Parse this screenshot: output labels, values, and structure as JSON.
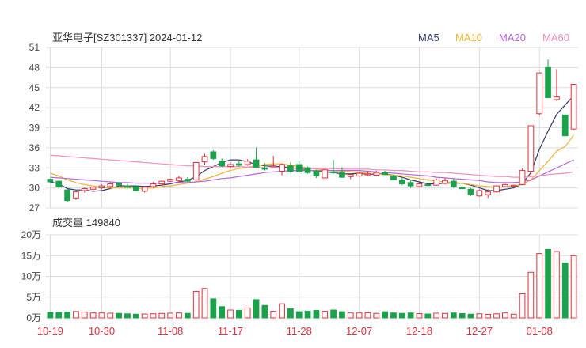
{
  "header": {
    "title": "亚华电子[SZ301337] 2024-01-12"
  },
  "legend": [
    {
      "label": "MA5",
      "color": "#2f3a6b"
    },
    {
      "label": "MA10",
      "color": "#f2b431"
    },
    {
      "label": "MA20",
      "color": "#b36ad8"
    },
    {
      "label": "MA60",
      "color": "#f08fc0"
    }
  ],
  "volume_panel": {
    "label": "成交量 149840"
  },
  "colors": {
    "up": "#e0303a",
    "down": "#1aa34a",
    "grid": "#dcdcdc"
  },
  "chart_data": [
    {
      "type": "candlestick",
      "title": "亚华电子[SZ301337] 2024-01-12",
      "ylim": [
        27,
        51
      ],
      "y_ticks": [
        27,
        30,
        33,
        36,
        39,
        42,
        45,
        48,
        51
      ],
      "x_tick_labels": [
        "10-19",
        "10-30",
        "11-08",
        "11-17",
        "11-28",
        "12-07",
        "12-18",
        "12-27",
        "01-08"
      ],
      "x_tick_indices": [
        0,
        6,
        14,
        21,
        29,
        36,
        43,
        50,
        57
      ],
      "grid": true,
      "legend_position": "top-right",
      "candles": [
        [
          31.3,
          31.4,
          30.7,
          30.9
        ],
        [
          31.0,
          31.1,
          29.9,
          30.2
        ],
        [
          29.7,
          29.8,
          27.9,
          28.1
        ],
        [
          28.5,
          29.6,
          28.2,
          29.4
        ],
        [
          29.6,
          30.1,
          29.3,
          29.9
        ],
        [
          29.8,
          30.3,
          29.5,
          30.1
        ],
        [
          30.0,
          30.5,
          29.8,
          30.3
        ],
        [
          30.2,
          30.8,
          30.0,
          30.6
        ],
        [
          30.7,
          30.9,
          30.2,
          30.4
        ],
        [
          30.3,
          30.6,
          29.9,
          30.1
        ],
        [
          30.2,
          30.4,
          29.5,
          29.6
        ],
        [
          29.5,
          30.2,
          29.3,
          30.1
        ],
        [
          30.2,
          30.9,
          30.0,
          30.6
        ],
        [
          30.6,
          31.2,
          30.5,
          31.0
        ],
        [
          31.0,
          31.4,
          30.9,
          31.3
        ],
        [
          31.1,
          31.8,
          30.9,
          31.5
        ],
        [
          31.3,
          31.6,
          30.9,
          31.0
        ],
        [
          31.2,
          34.0,
          31.0,
          33.8
        ],
        [
          33.9,
          35.1,
          33.5,
          34.7
        ],
        [
          35.4,
          35.6,
          34.2,
          34.4
        ],
        [
          34.0,
          34.4,
          33.1,
          33.3
        ],
        [
          33.2,
          33.8,
          33.0,
          33.5
        ],
        [
          33.6,
          34.0,
          33.2,
          33.4
        ],
        [
          33.5,
          34.3,
          33.3,
          34.0
        ],
        [
          34.2,
          36.0,
          33.0,
          33.1
        ],
        [
          33.0,
          33.7,
          32.6,
          32.8
        ],
        [
          33.2,
          34.8,
          33.1,
          33.3
        ],
        [
          32.5,
          33.7,
          31.9,
          33.5
        ],
        [
          33.3,
          33.8,
          32.3,
          32.5
        ],
        [
          33.5,
          34.0,
          32.3,
          32.5
        ],
        [
          33.0,
          33.2,
          32.1,
          32.3
        ],
        [
          32.5,
          32.7,
          31.5,
          31.8
        ],
        [
          31.5,
          32.9,
          31.3,
          32.7
        ],
        [
          32.4,
          34.2,
          32.1,
          32.3
        ],
        [
          32.3,
          33.1,
          31.5,
          31.6
        ],
        [
          31.7,
          32.1,
          31.3,
          32.0
        ],
        [
          31.8,
          32.4,
          31.7,
          32.2
        ],
        [
          32.0,
          32.5,
          31.8,
          32.1
        ],
        [
          31.9,
          32.6,
          31.8,
          32.3
        ],
        [
          32.3,
          32.6,
          31.9,
          32.0
        ],
        [
          31.8,
          32.0,
          31.1,
          31.2
        ],
        [
          31.2,
          31.6,
          30.4,
          30.6
        ],
        [
          30.8,
          31.2,
          30.0,
          30.3
        ],
        [
          30.2,
          30.9,
          30.1,
          30.6
        ],
        [
          30.5,
          30.8,
          30.2,
          30.4
        ],
        [
          30.4,
          31.4,
          30.3,
          31.2
        ],
        [
          30.7,
          31.5,
          30.5,
          31.1
        ],
        [
          31.0,
          31.4,
          30.0,
          30.2
        ],
        [
          30.1,
          30.3,
          29.7,
          29.9
        ],
        [
          29.8,
          30.0,
          28.8,
          29.0
        ],
        [
          28.8,
          29.8,
          28.7,
          29.6
        ],
        [
          29.0,
          29.8,
          28.5,
          29.4
        ],
        [
          29.4,
          30.4,
          29.3,
          30.3
        ],
        [
          30.2,
          30.6,
          30.1,
          30.5
        ],
        [
          30.3,
          30.5,
          30.1,
          30.4
        ],
        [
          30.5,
          32.9,
          30.4,
          32.6
        ],
        [
          32.5,
          39.3,
          31.0,
          39.3
        ],
        [
          41.1,
          47.2,
          40.9,
          47.2
        ],
        [
          48.0,
          49.2,
          43.4,
          43.5
        ],
        [
          43.2,
          47.8,
          43.0,
          43.6
        ],
        [
          40.9,
          41.0,
          37.7,
          37.8
        ],
        [
          38.8,
          45.5,
          38.7,
          45.5
        ]
      ],
      "ma_series": [
        {
          "name": "MA5",
          "values": [
            30.9,
            30.6,
            29.9,
            29.7,
            29.7,
            29.5,
            29.6,
            29.9,
            30.3,
            30.3,
            30.3,
            30.2,
            30.3,
            30.4,
            30.6,
            30.9,
            31.1,
            31.7,
            32.6,
            33.2,
            33.8,
            34.2,
            34.2,
            33.9,
            33.5,
            33.3,
            33.2,
            33.2,
            33.0,
            32.9,
            32.7,
            32.5,
            32.4,
            32.3,
            32.1,
            32.1,
            32.2,
            32.0,
            32.1,
            32.1,
            31.9,
            31.6,
            31.2,
            30.9,
            30.6,
            30.6,
            30.7,
            30.7,
            30.7,
            30.4,
            30.0,
            29.6,
            29.6,
            29.8,
            30.0,
            30.6,
            32.3,
            35.8,
            38.5,
            41.0,
            42.4,
            43.8
          ]
        },
        {
          "name": "MA10",
          "values": [
            32.2,
            31.8,
            31.2,
            30.8,
            30.5,
            30.3,
            30.1,
            30.0,
            30.0,
            30.0,
            30.0,
            29.9,
            30.0,
            30.2,
            30.3,
            30.5,
            30.7,
            30.9,
            31.3,
            31.7,
            32.2,
            32.6,
            32.9,
            33.1,
            33.3,
            33.5,
            33.6,
            33.6,
            33.4,
            33.2,
            33.0,
            32.8,
            32.7,
            32.6,
            32.5,
            32.4,
            32.3,
            32.2,
            32.1,
            32.0,
            31.9,
            31.8,
            31.6,
            31.4,
            31.2,
            31.0,
            30.9,
            30.8,
            30.7,
            30.5,
            30.3,
            30.2,
            30.1,
            30.2,
            30.3,
            30.5,
            31.2,
            32.6,
            34.0,
            35.5,
            36.2,
            37.9
          ]
        },
        {
          "name": "MA20",
          "values": [
            31.6,
            31.5,
            31.4,
            31.3,
            31.2,
            31.1,
            31.0,
            30.9,
            30.8,
            30.8,
            30.7,
            30.7,
            30.7,
            30.7,
            30.7,
            30.8,
            30.8,
            30.9,
            31.0,
            31.2,
            31.4,
            31.5,
            31.7,
            31.9,
            32.1,
            32.3,
            32.4,
            32.5,
            32.6,
            32.6,
            32.6,
            32.6,
            32.6,
            32.6,
            32.6,
            32.6,
            32.6,
            32.5,
            32.4,
            32.3,
            32.2,
            32.1,
            32.0,
            31.9,
            31.8,
            31.6,
            31.5,
            31.4,
            31.3,
            31.2,
            31.1,
            30.9,
            30.8,
            30.8,
            30.8,
            30.9,
            31.2,
            31.8,
            32.4,
            33.0,
            33.6,
            34.2
          ]
        },
        {
          "name": "MA60",
          "values": [
            34.9,
            34.8,
            34.7,
            34.6,
            34.5,
            34.4,
            34.3,
            34.2,
            34.1,
            34.0,
            33.9,
            33.8,
            33.7,
            33.6,
            33.5,
            33.4,
            33.3,
            33.3,
            33.2,
            33.2,
            33.2,
            33.2,
            33.2,
            33.1,
            33.1,
            33.0,
            33.0,
            33.0,
            33.0,
            32.9,
            32.9,
            32.9,
            32.9,
            32.9,
            32.8,
            32.8,
            32.8,
            32.8,
            32.7,
            32.7,
            32.6,
            32.6,
            32.5,
            32.4,
            32.4,
            32.3,
            32.3,
            32.2,
            32.1,
            32.0,
            31.9,
            31.8,
            31.7,
            31.7,
            31.6,
            31.6,
            31.7,
            31.8,
            32.0,
            32.1,
            32.2,
            32.4
          ]
        }
      ]
    },
    {
      "type": "bar",
      "title": "成交量 149840",
      "ylim": [
        0,
        200000
      ],
      "y_tick_labels": [
        "0万",
        "5万",
        "10万",
        "15万",
        "20万"
      ],
      "grid": true,
      "volumes": [
        13500,
        13000,
        14000,
        15500,
        14000,
        12000,
        12000,
        11500,
        11000,
        10000,
        9000,
        9500,
        10000,
        11000,
        11500,
        12000,
        11000,
        64000,
        71000,
        46000,
        27000,
        19000,
        18000,
        24000,
        44000,
        30000,
        16000,
        34000,
        22000,
        15000,
        16000,
        18000,
        16000,
        19000,
        15000,
        12000,
        12000,
        12500,
        11000,
        15000,
        12000,
        11000,
        12000,
        10500,
        9500,
        11500,
        11000,
        12000,
        10500,
        9000,
        10000,
        8500,
        10000,
        12000,
        9000,
        58000,
        110000,
        155000,
        165000,
        160000,
        132000,
        149840
      ]
    }
  ]
}
